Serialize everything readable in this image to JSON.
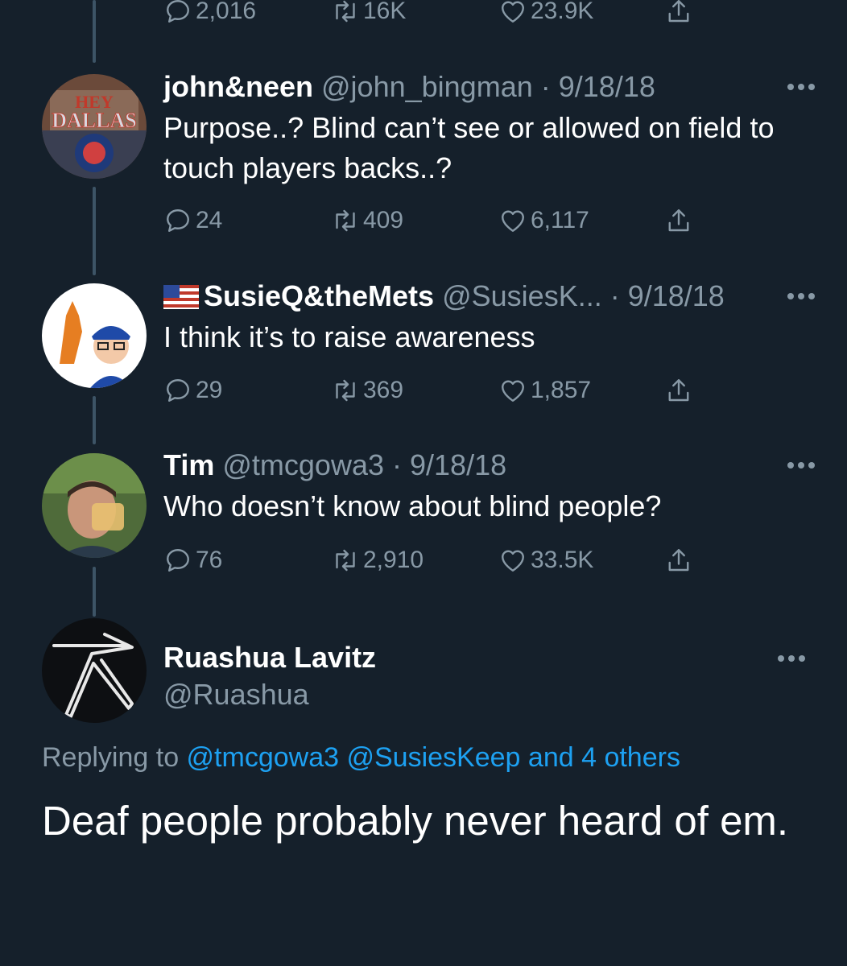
{
  "top_tweet": {
    "actions": {
      "replies": "2,016",
      "retweets": "16K",
      "likes": "23.9K"
    }
  },
  "replies": [
    {
      "name": "john&neen",
      "handle": "@john_bingman",
      "sep": " · ",
      "date": "9/18/18",
      "text": "Purpose..?  Blind can’t see or allowed on field to touch players backs..?",
      "avatar_text": {
        "line1": "HEY",
        "line2": "DALLAS"
      },
      "actions": {
        "replies": "24",
        "retweets": "409",
        "likes": "6,117"
      }
    },
    {
      "flag": "🇺🇸",
      "name": "SusieQ&theMets",
      "handle": "@SusiesK...",
      "sep": " · ",
      "date": "9/18/18",
      "text": "I think it’s to raise awareness",
      "actions": {
        "replies": "29",
        "retweets": "369",
        "likes": "1,857"
      }
    },
    {
      "name": "Tim",
      "handle": "@tmcgowa3",
      "sep": " · ",
      "date": "9/18/18",
      "text": "Who doesn’t know about blind people?",
      "actions": {
        "replies": "76",
        "retweets": "2,910",
        "likes": "33.5K"
      }
    }
  ],
  "main_tweet": {
    "name": "Ruashua Lavitz",
    "handle": "@Ruashua",
    "replying_to_prefix": "Replying to ",
    "mention1": "@tmcgowa3",
    "mention2": "@SusiesKeep",
    "others": "and 4 others",
    "text": "Deaf people probably never heard of em."
  },
  "colors": {
    "background": "#15202b",
    "secondary_text": "#8899a6",
    "link": "#1da1f2",
    "thread_line": "#3d5466"
  },
  "icons": [
    "reply-icon",
    "retweet-icon",
    "like-icon",
    "share-icon",
    "more-icon"
  ]
}
